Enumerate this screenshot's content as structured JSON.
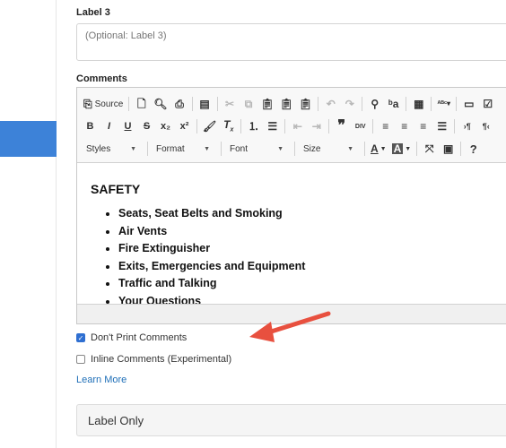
{
  "label3": {
    "title": "Label 3",
    "placeholder": "(Optional: Label 3)"
  },
  "comments": {
    "title": "Comments"
  },
  "toolbar": {
    "source_label": "Source",
    "combos": {
      "styles": "Styles",
      "format": "Format",
      "font": "Font",
      "size": "Size"
    },
    "bold": "B",
    "italic": "I",
    "underline": "U",
    "strike": "S",
    "subscript": "x₂",
    "superscript": "x²",
    "help": "?"
  },
  "editor_content": {
    "heading": "SAFETY",
    "items": [
      "Seats, Seat Belts and Smoking",
      "Air Vents",
      "Fire Extinguisher",
      "Exits, Emergencies and Equipment",
      "Traffic and Talking",
      "Your Questions"
    ]
  },
  "options": {
    "dont_print": {
      "label": "Don't Print Comments",
      "checked": true
    },
    "inline": {
      "label": "Inline Comments (Experimental)",
      "checked": false
    }
  },
  "learn_more": "Learn More",
  "label_only": "Label Only",
  "colors": {
    "accent": "#3d82d8",
    "link": "#1f6fb8",
    "arrow": "#e8503f"
  }
}
